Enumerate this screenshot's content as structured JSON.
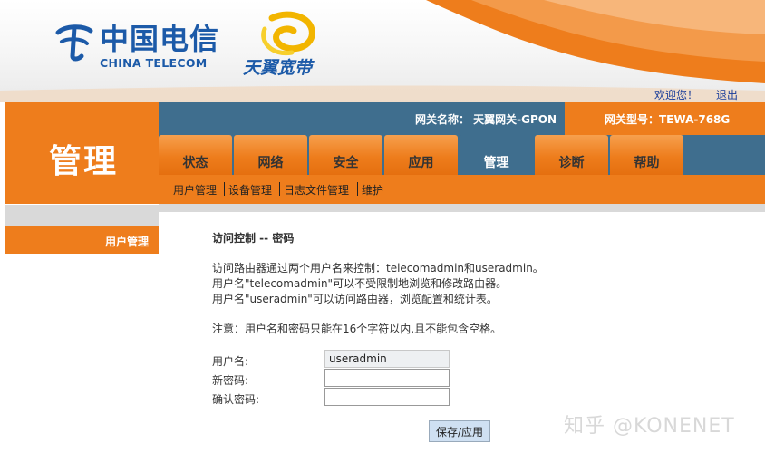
{
  "brand": {
    "cn_name": "中国电信",
    "en_name": "CHINA TELECOM",
    "product": "天翼宽带"
  },
  "header": {
    "welcome": "欢迎您！",
    "logout": "退出"
  },
  "info": {
    "gateway_name": "网关名称：  天翼网关-GPON",
    "gateway_model": "网关型号：TEWA-768G"
  },
  "page_title": "管理",
  "tabs": [
    {
      "label": "状态"
    },
    {
      "label": "网络"
    },
    {
      "label": "安全"
    },
    {
      "label": "应用"
    },
    {
      "label": "管理"
    },
    {
      "label": "诊断"
    },
    {
      "label": "帮助"
    }
  ],
  "active_tab": "管理",
  "subnav": [
    {
      "label": "用户管理"
    },
    {
      "label": "设备管理"
    },
    {
      "label": "日志文件管理"
    },
    {
      "label": "维护"
    }
  ],
  "sidebar": {
    "items": [
      {
        "label": "用户管理"
      }
    ]
  },
  "content": {
    "section_title": "访问控制 -- 密码",
    "desc_line1": "访问路由器通过两个用户名来控制：telecomadmin和useradmin。",
    "desc_line2": "用户名\"telecomadmin\"可以不受限制地浏览和修改路由器。",
    "desc_line3": "用户名\"useradmin\"可以访问路由器，浏览配置和统计表。",
    "note": "注意：用户名和密码只能在16个字符以内,且不能包含空格。",
    "username_label": "用户名:",
    "username_value": "useradmin",
    "new_password_label": "新密码:",
    "new_password_value": "",
    "confirm_password_label": "确认密码:",
    "confirm_password_value": "",
    "save_label": "保存/应用"
  },
  "watermark": "知乎 @KONENET",
  "colors": {
    "orange": "#ee7d1c",
    "blue_band": "#3f6e8e",
    "brand_blue": "#1c5aa8",
    "link_blue": "#1a3d9a",
    "gray_strip": "#d9d9d9"
  }
}
